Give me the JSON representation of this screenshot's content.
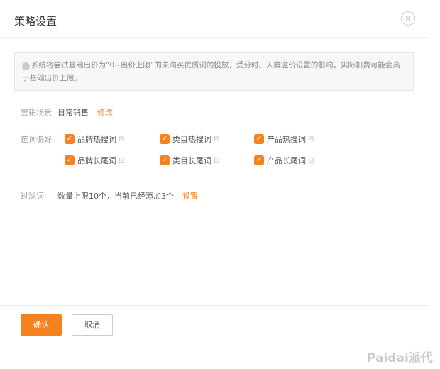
{
  "dialog": {
    "title": "策略设置"
  },
  "notice": {
    "text": "系统将尝试基础出价为“0~出价上限”的未购买优质词的投放，受分时、人群溢价设置的影响，实际扣费可能会高于基础出价上限。"
  },
  "scene": {
    "label": "营销场景",
    "value": "日常销售",
    "action": "修改"
  },
  "preference": {
    "label": "选词偏好",
    "options": [
      {
        "label": "品牌热搜词",
        "checked": true
      },
      {
        "label": "类目热搜词",
        "checked": true
      },
      {
        "label": "产品热搜词",
        "checked": true
      },
      {
        "label": "品牌长尾词",
        "checked": true
      },
      {
        "label": "类目长尾词",
        "checked": true
      },
      {
        "label": "产品长尾词",
        "checked": true
      }
    ]
  },
  "filter": {
    "label": "过滤词",
    "value": "数量上限10个，当前已经添加3个",
    "action": "设置"
  },
  "footer": {
    "confirm": "确认",
    "cancel": "取消"
  },
  "watermark": "Paidai派代",
  "colors": {
    "accent": "#f5821f"
  }
}
